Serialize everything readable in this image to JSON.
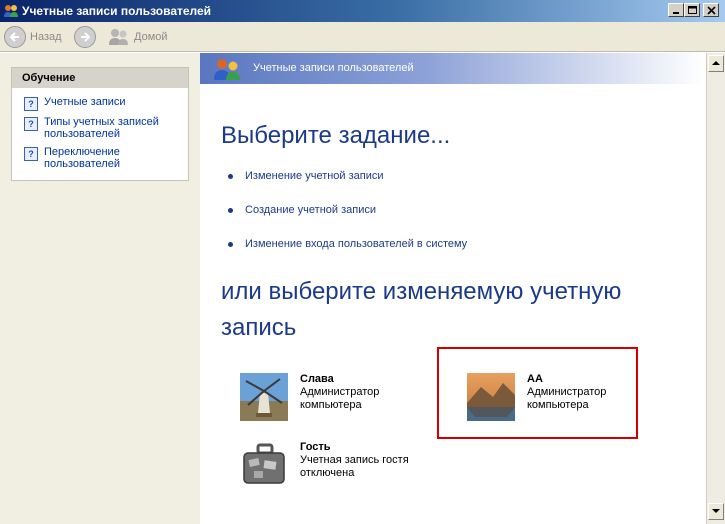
{
  "window": {
    "title": "Учетные записи пользователей",
    "controls": [
      "minimize",
      "maximize",
      "close"
    ]
  },
  "toolbar": {
    "back_label": "Назад",
    "home_label": "Домой"
  },
  "sidebar": {
    "header": "Обучение",
    "items": [
      {
        "label": "Учетные записи"
      },
      {
        "label": "Типы учетных записей пользователей"
      },
      {
        "label": "Переключение пользователей"
      }
    ]
  },
  "banner": {
    "title": "Учетные записи пользователей"
  },
  "main": {
    "heading": "Выберите задание...",
    "tasks": [
      {
        "label": "Изменение учетной записи"
      },
      {
        "label": "Создание учетной записи"
      },
      {
        "label": "Изменение входа пользователей в систему"
      }
    ],
    "subheading": "или выберите изменяемую учетную запись",
    "accounts": [
      {
        "name": "Слава",
        "description": "Администратор компьютера",
        "icon": "windmill-icon"
      },
      {
        "name": "АА",
        "description": "Администратор компьютера",
        "icon": "landscape-icon"
      },
      {
        "name": "Гость",
        "description": "Учетная запись гостя отключена",
        "icon": "suitcase-icon"
      }
    ]
  },
  "colors": {
    "heading": "#1b3a8a",
    "link": "#0033a0",
    "highlight": "#d40000",
    "sidebar_bg": "#f1efe2"
  }
}
